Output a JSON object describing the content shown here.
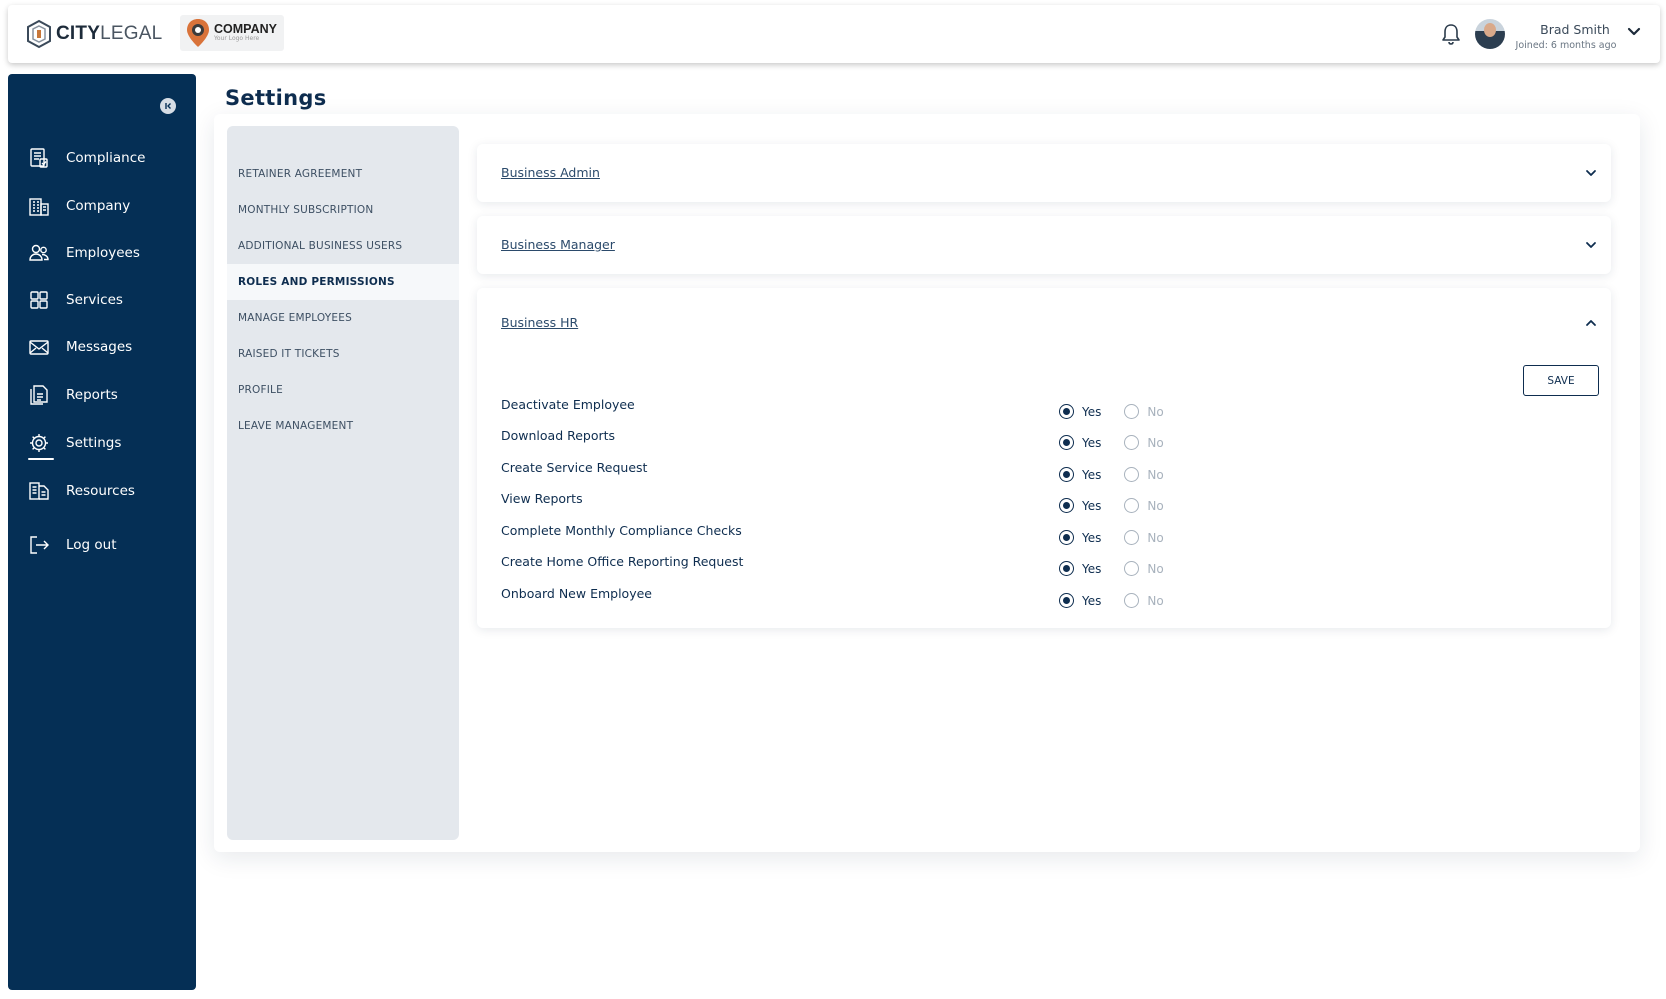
{
  "header": {
    "brand_bold": "CITY",
    "brand_light": "LEGAL",
    "company_name": "COMPANY",
    "company_tagline": "Your Logo Here",
    "user_name": "Brad Smith",
    "user_joined": "Joined: 6 months ago"
  },
  "sidebar": {
    "items": [
      {
        "label": "Compliance",
        "icon": "compliance-icon"
      },
      {
        "label": "Company",
        "icon": "building-icon"
      },
      {
        "label": "Employees",
        "icon": "users-icon"
      },
      {
        "label": "Services",
        "icon": "grid-icon"
      },
      {
        "label": "Messages",
        "icon": "mail-icon"
      },
      {
        "label": "Reports",
        "icon": "report-icon"
      },
      {
        "label": "Settings",
        "icon": "gear-icon",
        "active": true
      },
      {
        "label": "Resources",
        "icon": "resources-icon"
      },
      {
        "label": "Log out",
        "icon": "logout-icon"
      }
    ]
  },
  "page": {
    "title": "Settings"
  },
  "settings_menu": {
    "items": [
      "RETAINER AGREEMENT",
      "MONTHLY SUBSCRIPTION",
      "ADDITIONAL BUSINESS USERS",
      "ROLES AND PERMISSIONS",
      "MANAGE EMPLOYEES",
      "RAISED IT TICKETS",
      "PROFILE",
      "LEAVE MANAGEMENT"
    ],
    "active": "ROLES AND PERMISSIONS"
  },
  "roles": {
    "admin": {
      "title": "Business Admin",
      "expanded": false
    },
    "manager": {
      "title": "Business Manager",
      "expanded": false
    },
    "hr": {
      "title": "Business HR",
      "expanded": true,
      "save_label": "SAVE",
      "yes_label": "Yes",
      "no_label": "No",
      "permissions": [
        {
          "label": "Deactivate Employee",
          "value": "Yes"
        },
        {
          "label": "Download Reports",
          "value": "Yes"
        },
        {
          "label": "Create Service Request",
          "value": "Yes"
        },
        {
          "label": "View Reports",
          "value": "Yes"
        },
        {
          "label": "Complete Monthly Compliance Checks",
          "value": "Yes"
        },
        {
          "label": "Create Home Office Reporting Request",
          "value": "Yes"
        },
        {
          "label": "Onboard New Employee",
          "value": "Yes"
        }
      ]
    }
  },
  "colors": {
    "sidebar_bg": "#052f55",
    "primary_text": "#0e2d4f",
    "menu_bg": "#e4e8ed"
  }
}
